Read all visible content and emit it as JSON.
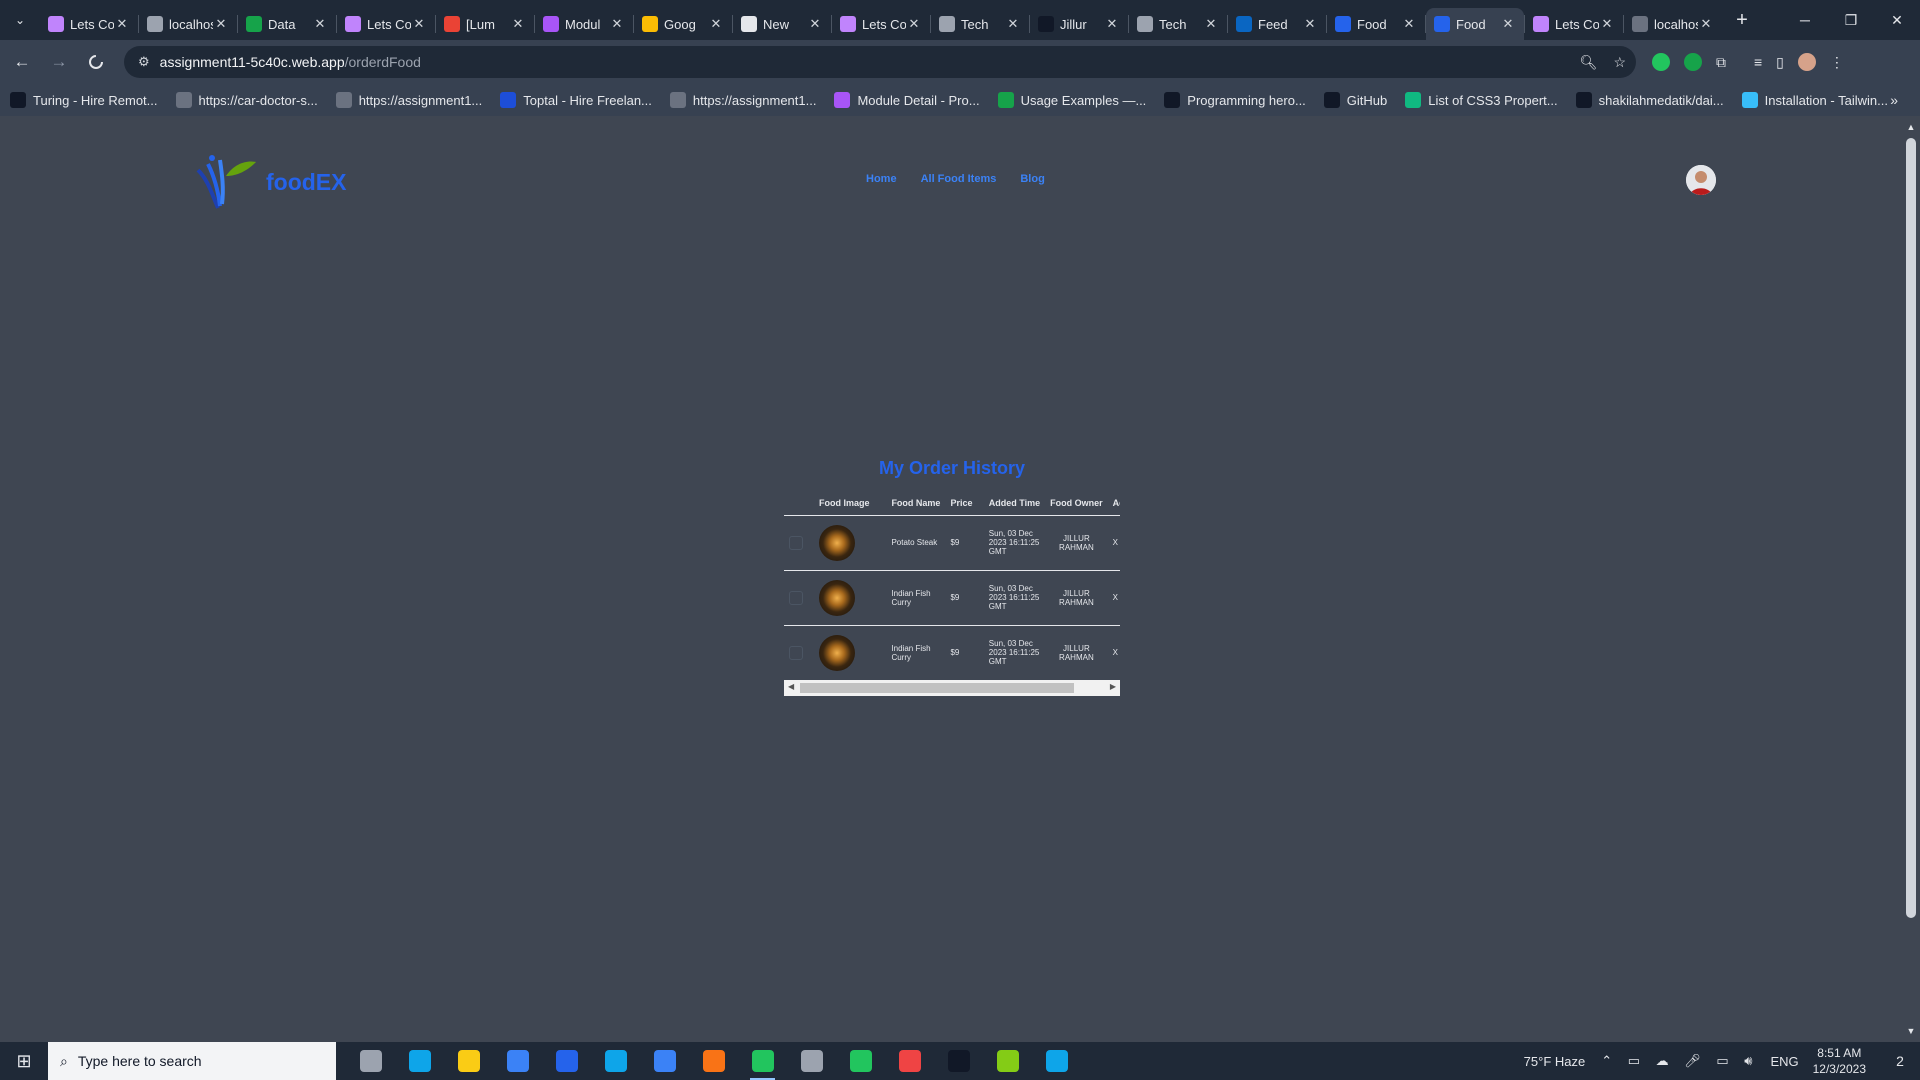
{
  "browser": {
    "tabs": [
      {
        "title": "Lets Code",
        "color": "#c084fc"
      },
      {
        "title": "localhost",
        "color": "#9ca3af"
      },
      {
        "title": "Data",
        "color": "#16a34a"
      },
      {
        "title": "Lets Code",
        "color": "#c084fc"
      },
      {
        "title": "[Lum",
        "color": "#ea4335"
      },
      {
        "title": "Modul",
        "color": "#a855f7"
      },
      {
        "title": "Goog",
        "color": "#fbbc04"
      },
      {
        "title": "New",
        "color": "#e5e7eb"
      },
      {
        "title": "Lets Code",
        "color": "#c084fc"
      },
      {
        "title": "Tech",
        "color": "#9ca3af"
      },
      {
        "title": "Jillur",
        "color": "#111827"
      },
      {
        "title": "Tech",
        "color": "#9ca3af"
      },
      {
        "title": "Feed",
        "color": "#0a66c2"
      },
      {
        "title": "Food",
        "color": "#2563eb"
      },
      {
        "title": "Food",
        "color": "#2563eb",
        "active": true
      },
      {
        "title": "Lets Code",
        "color": "#c084fc"
      },
      {
        "title": "localhost",
        "color": "#6b7280"
      }
    ],
    "url_host": "assignment11-5c40c.web.app",
    "url_path": "/orderdFood",
    "bookmarks": [
      {
        "label": "Turing - Hire Remot...",
        "color": "#111827"
      },
      {
        "label": "https://car-doctor-s...",
        "color": "#6b7280"
      },
      {
        "label": "https://assignment1...",
        "color": "#6b7280"
      },
      {
        "label": "Toptal - Hire Freelan...",
        "color": "#1d4ed8"
      },
      {
        "label": "https://assignment1...",
        "color": "#6b7280"
      },
      {
        "label": "Module Detail - Pro...",
        "color": "#a855f7"
      },
      {
        "label": "Usage Examples —...",
        "color": "#16a34a"
      },
      {
        "label": "Programming hero...",
        "color": "#111827"
      },
      {
        "label": "GitHub",
        "color": "#111827"
      },
      {
        "label": "List of CSS3 Propert...",
        "color": "#10b981"
      },
      {
        "label": "shakilahmedatik/dai...",
        "color": "#111827"
      },
      {
        "label": "Installation - Tailwin...",
        "color": "#38bdf8"
      }
    ]
  },
  "page": {
    "logo_text": "foodEX",
    "nav": [
      "Home",
      "All Food Items",
      "Blog"
    ],
    "heading": "My Order History",
    "columns": [
      "",
      "Food Image",
      "Food Name",
      "Price",
      "Added Time",
      "Food Owner",
      "Acti"
    ],
    "rows": [
      {
        "name": "Potato Steak",
        "price": "$9",
        "time": "Sun, 03 Dec 2023 16:11:25 GMT",
        "owner": "JILLUR RAHMAN",
        "action": "X"
      },
      {
        "name": "Indian Fish Curry",
        "price": "$9",
        "time": "Sun, 03 Dec 2023 16:11:25 GMT",
        "owner": "JILLUR RAHMAN",
        "action": "X"
      },
      {
        "name": "Indian Fish Curry",
        "price": "$9",
        "time": "Sun, 03 Dec 2023 16:11:25 GMT",
        "owner": "JILLUR RAHMAN",
        "action": "X"
      }
    ]
  },
  "taskbar": {
    "search_placeholder": "Type here to search",
    "weather": "75°F Haze",
    "language": "ENG",
    "time": "8:51 AM",
    "date": "12/3/2023",
    "notification_count": "2",
    "apps": [
      {
        "name": "task-view",
        "color": "#9ca3af"
      },
      {
        "name": "edge",
        "color": "#0ea5e9"
      },
      {
        "name": "file-explorer",
        "color": "#facc15"
      },
      {
        "name": "store",
        "color": "#3b82f6"
      },
      {
        "name": "mail",
        "color": "#2563eb"
      },
      {
        "name": "skype",
        "color": "#0ea5e9"
      },
      {
        "name": "vscode",
        "color": "#3b82f6"
      },
      {
        "name": "firefox",
        "color": "#f97316"
      },
      {
        "name": "chrome",
        "color": "#22c55e",
        "active": true
      },
      {
        "name": "printer-app",
        "color": "#9ca3af"
      },
      {
        "name": "whatsapp",
        "color": "#22c55e"
      },
      {
        "name": "anydesk",
        "color": "#ef4444"
      },
      {
        "name": "terminal",
        "color": "#111827"
      },
      {
        "name": "notepad",
        "color": "#84cc16"
      },
      {
        "name": "azure-app",
        "color": "#0ea5e9"
      }
    ]
  }
}
